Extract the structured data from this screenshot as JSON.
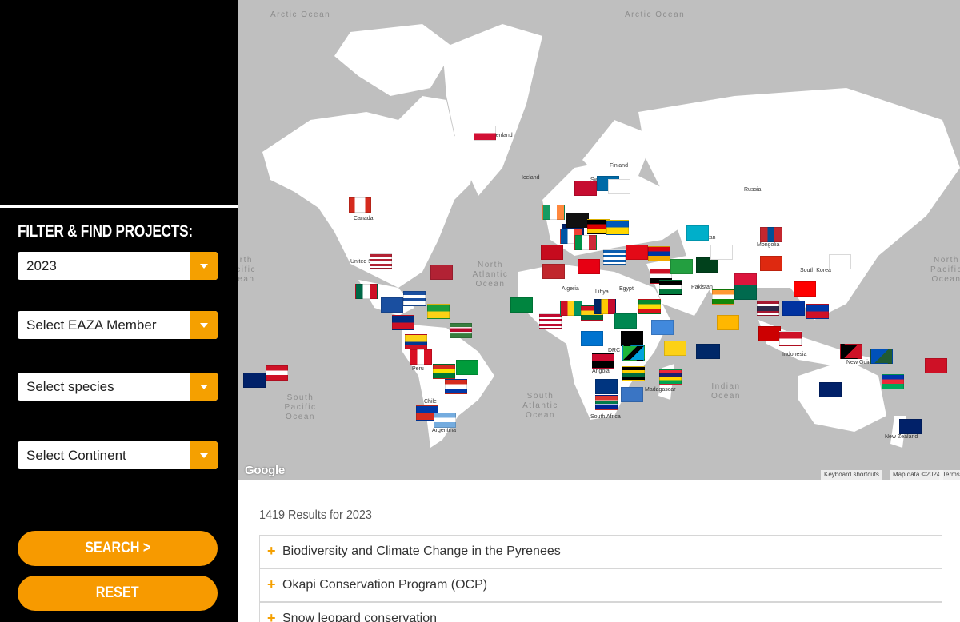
{
  "filter": {
    "title": "FILTER & FIND PROJECTS:",
    "year": "2023",
    "member_placeholder": "Select EAZA Member",
    "species_placeholder": "Select species",
    "continent_placeholder": "Select Continent",
    "search_label": "SEARCH >",
    "reset_label": "RESET"
  },
  "map": {
    "oceans": {
      "arctic_left": "Arctic Ocean",
      "arctic_right": "Arctic Ocean",
      "north_atlantic": "North Atlantic Ocean",
      "south_atlantic": "South Atlantic Ocean",
      "south_pacific": "South Pacific Ocean",
      "indian": "Indian Ocean",
      "north_pacific": "North Pacific Ocean",
      "north_pacific_left": "North Pacific Ocean"
    },
    "places": {
      "greenland": "Greenland",
      "canada": "Canada",
      "united_states": "United States",
      "iceland": "Iceland",
      "finland": "Finland",
      "sweden": "Sweden",
      "russia": "Russia",
      "kazakhstan": "Kazakhstan",
      "mongolia": "Mongolia",
      "south_korea": "South Korea",
      "pakistan": "Pakistan",
      "libya": "Libya",
      "egypt": "Egypt",
      "algeria": "Algeria",
      "peru": "Peru",
      "chile": "Chile",
      "argentina": "Argentina",
      "angola": "Angola",
      "drc": "DRC",
      "madagascar": "Madagascar",
      "south_africa": "South Africa",
      "indonesia": "Indonesia",
      "new_guinea": "New Guinea",
      "new_zealand": "New Zealand"
    },
    "google": "Google",
    "keyboard": "Keyboard shortcuts",
    "map_data": "Map data ©2024",
    "terms": "Terms"
  },
  "results": {
    "count_label": "1419 Results for 2023",
    "items": [
      "Biodiversity and Climate Change in the Pyrenees",
      "Okapi Conservation Program (OCP)",
      "Snow leopard conservation"
    ]
  },
  "colors": {
    "accent": "#f79a00",
    "sidebar": "#000000",
    "map_water": "#bfbfbf",
    "map_land": "#ffffff"
  }
}
